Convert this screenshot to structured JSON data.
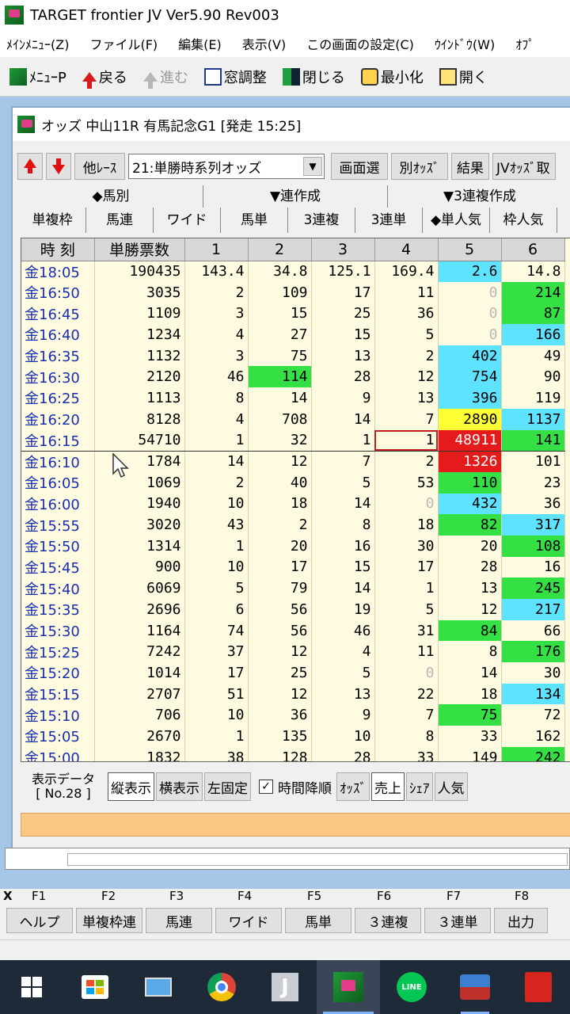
{
  "app": {
    "title": "TARGET frontier JV  Ver5.90  Rev003"
  },
  "menu": [
    "ﾒｲﾝﾒﾆｭｰ(Z)",
    "ファイル(F)",
    "編集(E)",
    "表示(V)",
    "この画面の設定(C)",
    "ｳｲﾝﾄﾞｳ(W)",
    "ｵﾌﾟ"
  ],
  "toolbar": {
    "menu": "ﾒﾆｭｰP",
    "back": "戻る",
    "forward": "進む",
    "adjust": "窓調整",
    "close": "閉じる",
    "minimize": "最小化",
    "open": "開く"
  },
  "window": {
    "title": "オッズ 中山11R 有馬記念G1 [発走 15:25]"
  },
  "controls": {
    "other_race": "他ﾚｰｽ",
    "select_value": "21:単勝時系列オッズ",
    "screen_select": "画面選",
    "separate_odds": "別ｵｯｽﾞ",
    "result": "結果",
    "jv_odds": "JVｵｯｽﾞ取"
  },
  "groups": [
    "◆馬別",
    "▼連作成",
    "▼3連複作成"
  ],
  "tabs": [
    "単複枠",
    "馬連",
    "ワイド",
    "馬単",
    "3連複",
    "3連単",
    "◆単人気",
    "枠人気"
  ],
  "grid": {
    "headers": [
      "時 刻",
      "単勝票数",
      "1",
      "2",
      "3",
      "4",
      "5",
      "6"
    ],
    "rows": [
      {
        "t": "金18:05",
        "v": [
          "190435",
          "143.4",
          "34.8",
          "125.1",
          "169.4",
          "2.6",
          "14.8"
        ],
        "c": [
          "",
          "",
          "",
          "",
          "",
          "cyan",
          ""
        ]
      },
      {
        "t": "金16:50",
        "v": [
          "3035",
          "2",
          "109",
          "17",
          "11",
          "0",
          "214"
        ],
        "c": [
          "",
          "",
          "",
          "",
          "",
          "blank",
          "green"
        ]
      },
      {
        "t": "金16:45",
        "v": [
          "1109",
          "3",
          "15",
          "25",
          "36",
          "0",
          "87"
        ],
        "c": [
          "",
          "",
          "",
          "",
          "",
          "blank",
          "green"
        ]
      },
      {
        "t": "金16:40",
        "v": [
          "1234",
          "4",
          "27",
          "15",
          "5",
          "0",
          "166"
        ],
        "c": [
          "",
          "",
          "",
          "",
          "",
          "blank",
          "cyan"
        ]
      },
      {
        "t": "金16:35",
        "v": [
          "1132",
          "3",
          "75",
          "13",
          "2",
          "402",
          "49"
        ],
        "c": [
          "",
          "",
          "",
          "",
          "",
          "cyan",
          ""
        ]
      },
      {
        "t": "金16:30",
        "v": [
          "2120",
          "46",
          "114",
          "28",
          "12",
          "754",
          "90"
        ],
        "c": [
          "",
          "",
          "green",
          "",
          "",
          "cyan",
          ""
        ]
      },
      {
        "t": "金16:25",
        "v": [
          "1113",
          "8",
          "14",
          "9",
          "13",
          "396",
          "119"
        ],
        "c": [
          "",
          "",
          "",
          "",
          "",
          "cyan",
          ""
        ]
      },
      {
        "t": "金16:20",
        "v": [
          "8128",
          "4",
          "708",
          "14",
          "7",
          "2890",
          "1137"
        ],
        "c": [
          "",
          "",
          "",
          "",
          "",
          "yellow",
          "cyan"
        ]
      },
      {
        "t": "金16:15",
        "v": [
          "54710",
          "1",
          "32",
          "1",
          "1",
          "48911",
          "141"
        ],
        "c": [
          "",
          "",
          "",
          "",
          "sel",
          "red",
          "green"
        ]
      },
      {
        "t": "金16:10",
        "v": [
          "1784",
          "14",
          "12",
          "7",
          "2",
          "1326",
          "101"
        ],
        "c": [
          "",
          "",
          "",
          "",
          "",
          "red",
          ""
        ]
      },
      {
        "t": "金16:05",
        "v": [
          "1069",
          "2",
          "40",
          "5",
          "53",
          "110",
          "23"
        ],
        "c": [
          "",
          "",
          "",
          "",
          "",
          "green",
          ""
        ]
      },
      {
        "t": "金16:00",
        "v": [
          "1940",
          "10",
          "18",
          "14",
          "0",
          "432",
          "36"
        ],
        "c": [
          "",
          "",
          "",
          "",
          "blank",
          "cyan",
          ""
        ]
      },
      {
        "t": "金15:55",
        "v": [
          "3020",
          "43",
          "2",
          "8",
          "18",
          "82",
          "317"
        ],
        "c": [
          "",
          "",
          "",
          "",
          "",
          "green",
          "cyan"
        ]
      },
      {
        "t": "金15:50",
        "v": [
          "1314",
          "1",
          "20",
          "16",
          "30",
          "20",
          "108"
        ],
        "c": [
          "",
          "",
          "",
          "",
          "",
          "",
          "green"
        ]
      },
      {
        "t": "金15:45",
        "v": [
          "900",
          "10",
          "17",
          "15",
          "17",
          "28",
          "16"
        ],
        "c": [
          "",
          "",
          "",
          "",
          "",
          "",
          ""
        ]
      },
      {
        "t": "金15:40",
        "v": [
          "6069",
          "5",
          "79",
          "14",
          "1",
          "13",
          "245"
        ],
        "c": [
          "",
          "",
          "",
          "",
          "",
          "",
          "green"
        ]
      },
      {
        "t": "金15:35",
        "v": [
          "2696",
          "6",
          "56",
          "19",
          "5",
          "12",
          "217"
        ],
        "c": [
          "",
          "",
          "",
          "",
          "",
          "",
          "cyan"
        ]
      },
      {
        "t": "金15:30",
        "v": [
          "1164",
          "74",
          "56",
          "46",
          "31",
          "84",
          "66"
        ],
        "c": [
          "",
          "",
          "",
          "",
          "",
          "green",
          ""
        ]
      },
      {
        "t": "金15:25",
        "v": [
          "7242",
          "37",
          "12",
          "4",
          "11",
          "8",
          "176"
        ],
        "c": [
          "",
          "",
          "",
          "",
          "",
          "",
          "green"
        ]
      },
      {
        "t": "金15:20",
        "v": [
          "1014",
          "17",
          "25",
          "5",
          "0",
          "14",
          "30"
        ],
        "c": [
          "",
          "",
          "",
          "",
          "blank",
          "",
          ""
        ]
      },
      {
        "t": "金15:15",
        "v": [
          "2707",
          "51",
          "12",
          "13",
          "22",
          "18",
          "134"
        ],
        "c": [
          "",
          "",
          "",
          "",
          "",
          "",
          "cyan"
        ]
      },
      {
        "t": "金15:10",
        "v": [
          "706",
          "10",
          "36",
          "9",
          "7",
          "75",
          "72"
        ],
        "c": [
          "",
          "",
          "",
          "",
          "",
          "green",
          ""
        ]
      },
      {
        "t": "金15:05",
        "v": [
          "2670",
          "1",
          "135",
          "10",
          "8",
          "33",
          "162"
        ],
        "c": [
          "",
          "",
          "",
          "",
          "",
          "",
          ""
        ]
      },
      {
        "t": "金15:00",
        "v": [
          "1832",
          "38",
          "128",
          "28",
          "33",
          "149",
          "242"
        ],
        "c": [
          "",
          "",
          "",
          "",
          "",
          "",
          "green"
        ]
      }
    ]
  },
  "bottom": {
    "disp_line1": "表示データ",
    "disp_line2": "[ No.28 ]",
    "vertical": "縦表示",
    "horizontal": "横表示",
    "fix_left": "左固定",
    "time_desc": "時間降順",
    "odds": "ｵｯｽﾞ",
    "sales": "売上",
    "share": "ｼｪｱ",
    "popularity": "人気"
  },
  "fkeys": {
    "labels": [
      "F1",
      "F2",
      "F3",
      "F4",
      "F5",
      "F6",
      "F7",
      "F8"
    ],
    "buttons": [
      "ヘルプ",
      "単複枠連",
      "馬連",
      "ワイド",
      "馬単",
      "３連複",
      "３連単",
      "出力"
    ],
    "x": "X"
  },
  "taskbar": {
    "line": "LINE"
  }
}
